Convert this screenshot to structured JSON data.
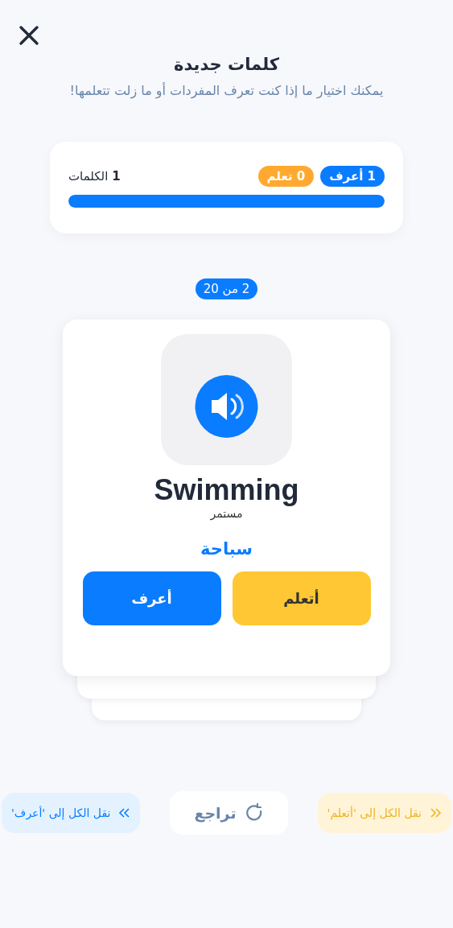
{
  "title": "كلمات جديدة",
  "subtitle": "يمكنك اختيار ما إذا كنت تعرف المفردات أو ما زلت تتعلمها!",
  "stats": {
    "badges": [
      {
        "label": "1 أعرف",
        "color": "#0a7cff"
      },
      {
        "label": "0 تعلم",
        "color": "#ffa930"
      }
    ],
    "words": "**1** الكلمات",
    "level": 1
  },
  "counter": "2 من 20",
  "card": {
    "word": "Swimming",
    "hint": "مستمر",
    "translation": "سباحة",
    "buttons": [
      {
        "label": "أتعلم",
        "kind": "learn"
      },
      {
        "label": "أعرف",
        "kind": "know"
      }
    ]
  },
  "footer": [
    {
      "label": "نقل الكل إلى 'أتعلم'",
      "kind": "learn"
    },
    {
      "label": "تراجع",
      "kind": "undo"
    },
    {
      "label": "نقل الكل إلى 'أعرف'",
      "kind": "know"
    }
  ]
}
